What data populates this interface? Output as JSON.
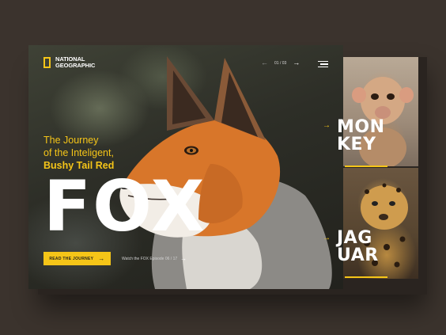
{
  "brand": {
    "line1": "NATIONAL",
    "line2": "GEOGRAPHIC"
  },
  "pager": {
    "current": "01",
    "total": "03",
    "separator": "/"
  },
  "headline": {
    "line1": "The Journey",
    "line2": "of the Inteligent,",
    "line3": "Bushy Tail Red"
  },
  "big_word": "FOX",
  "cta": {
    "label": "READ THE JOURNEY"
  },
  "watch": {
    "label": "Watch the FOX Episode 06 / 17"
  },
  "cards": [
    {
      "line1": "MON",
      "line2": "KEY"
    },
    {
      "line1": "JAG",
      "line2": "UAR"
    }
  ],
  "colors": {
    "accent": "#f5c518",
    "background": "#3b332d",
    "text": "#ffffff"
  },
  "icons": {
    "logo": "rectangle-frame-icon",
    "prev": "arrow-left-icon",
    "next": "arrow-right-icon",
    "menu": "hamburger-menu-icon",
    "cta": "arrow-right-icon",
    "card": "arrow-right-icon"
  }
}
